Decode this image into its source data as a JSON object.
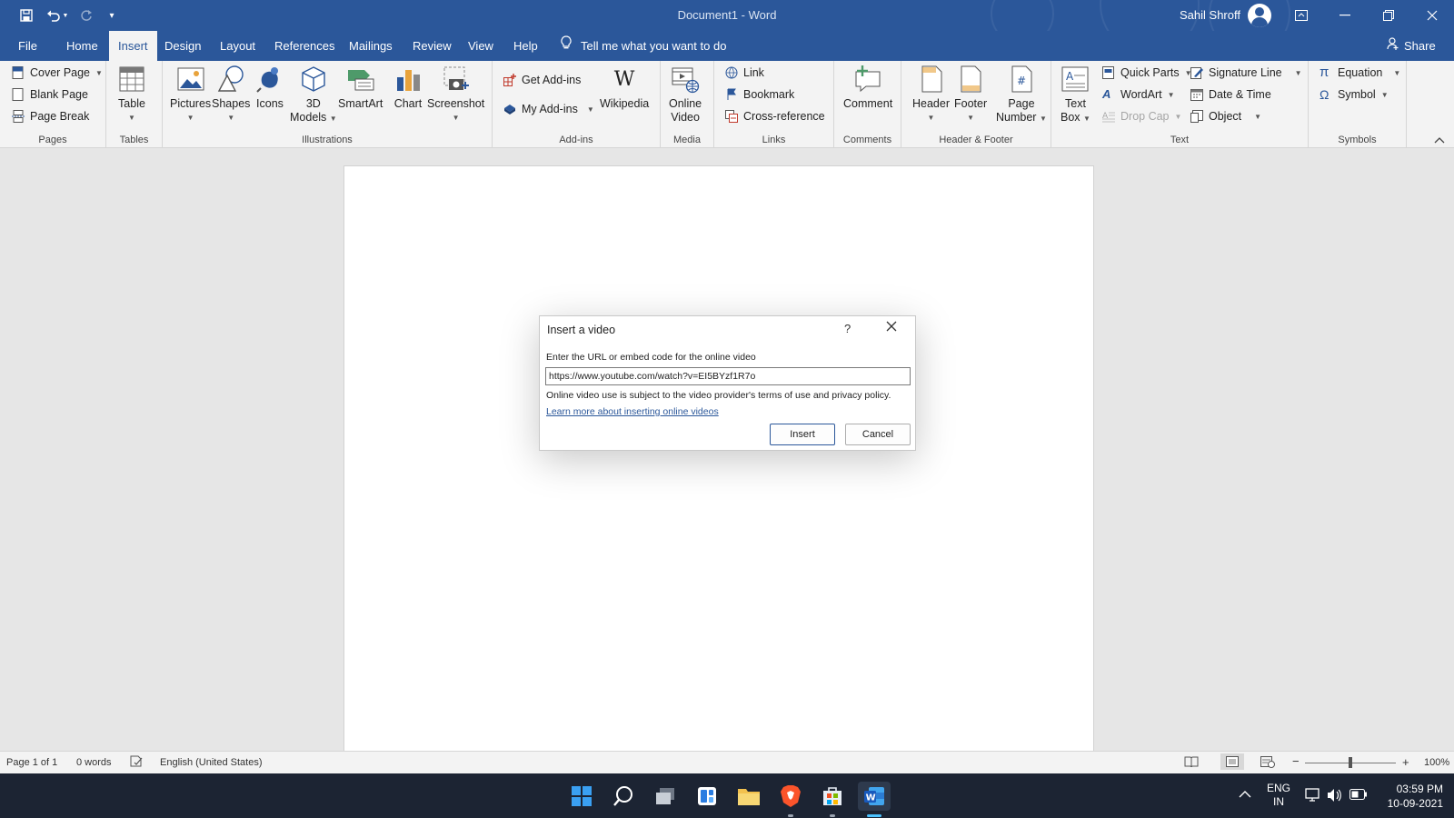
{
  "titlebar": {
    "document_title": "Document1  -  Word",
    "user_name": "Sahil Shroff"
  },
  "tabs": [
    {
      "label": "File"
    },
    {
      "label": "Home"
    },
    {
      "label": "Insert"
    },
    {
      "label": "Design"
    },
    {
      "label": "Layout"
    },
    {
      "label": "References"
    },
    {
      "label": "Mailings"
    },
    {
      "label": "Review"
    },
    {
      "label": "View"
    },
    {
      "label": "Help"
    }
  ],
  "tell_me": "Tell me what you want to do",
  "share_label": "Share",
  "ribbon": {
    "pages": {
      "label": "Pages",
      "cover_page": "Cover Page",
      "blank_page": "Blank Page",
      "page_break": "Page Break"
    },
    "tables": {
      "label": "Tables",
      "table": "Table"
    },
    "illustrations": {
      "label": "Illustrations",
      "pictures": "Pictures",
      "shapes": "Shapes",
      "icons": "Icons",
      "models_line1": "3D",
      "models_line2": "Models",
      "smartart": "SmartArt",
      "chart": "Chart",
      "screenshot": "Screenshot"
    },
    "addins": {
      "label": "Add-ins",
      "get_addins": "Get Add-ins",
      "my_addins": "My Add-ins",
      "wikipedia": "Wikipedia"
    },
    "media": {
      "label": "Media",
      "online_line1": "Online",
      "online_line2": "Video"
    },
    "links": {
      "label": "Links",
      "link": "Link",
      "bookmark": "Bookmark",
      "cross_reference": "Cross-reference"
    },
    "comments": {
      "label": "Comments",
      "comment": "Comment"
    },
    "header_footer": {
      "label": "Header & Footer",
      "header": "Header",
      "footer": "Footer",
      "page_line1": "Page",
      "page_line2": "Number"
    },
    "text": {
      "label": "Text",
      "textbox_line1": "Text",
      "textbox_line2": "Box",
      "quick_parts": "Quick Parts",
      "wordart": "WordArt",
      "drop_cap": "Drop Cap",
      "signature_line": "Signature Line",
      "date_time": "Date & Time",
      "object": "Object"
    },
    "symbols": {
      "label": "Symbols",
      "equation": "Equation",
      "symbol": "Symbol"
    }
  },
  "dialog": {
    "title": "Insert a video",
    "help": "?",
    "prompt": "Enter the URL or embed code for the online video",
    "url_value": "https://www.youtube.com/watch?v=EI5BYzf1R7o",
    "terms": "Online video use is subject to the video provider's terms of use and privacy policy.",
    "learn_more": "Learn more about inserting online videos",
    "insert_label": "Insert",
    "cancel_label": "Cancel"
  },
  "statusbar": {
    "page": "Page 1 of 1",
    "words": "0 words",
    "language": "English (United States)",
    "zoom": "100%",
    "zoom_minus": "−",
    "zoom_plus": "+"
  },
  "taskbar": {
    "lang_line1": "ENG",
    "lang_line2": "IN",
    "time": "03:59 PM",
    "date": "10-09-2021"
  },
  "colors": {
    "word_blue": "#2b579a",
    "taskbar": "#1c2433",
    "ribbon_bg": "#f3f3f3"
  }
}
